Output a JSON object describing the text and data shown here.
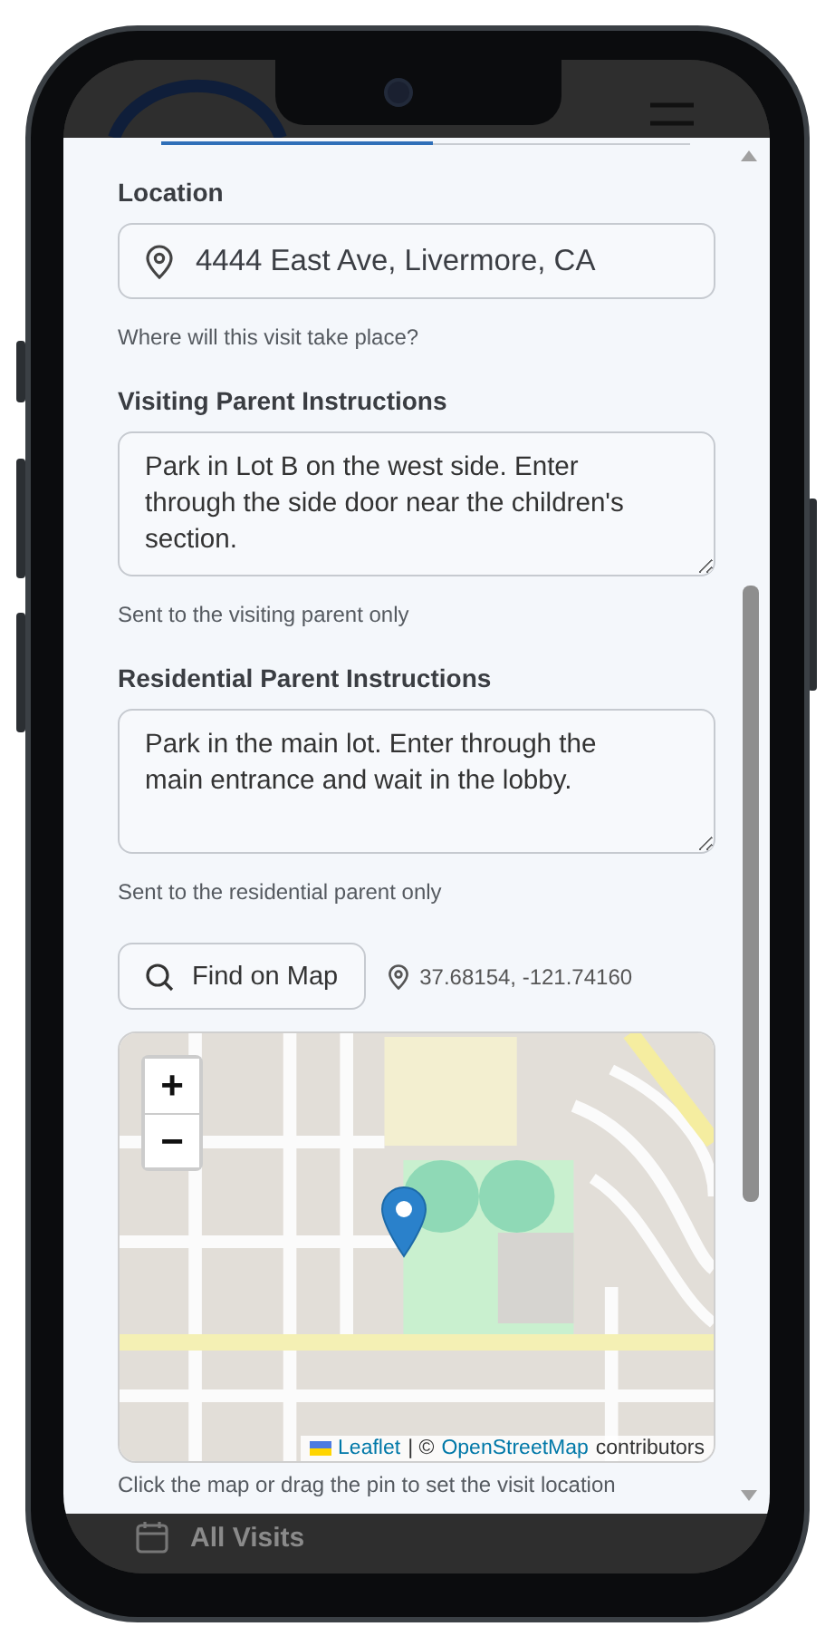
{
  "background_page": {
    "nav_item": "All Visits"
  },
  "location": {
    "label": "Location",
    "value": "4444 East Ave, Livermore, CA",
    "hint": "Where will this visit take place?"
  },
  "visiting_instructions": {
    "label": "Visiting Parent Instructions",
    "value": "Park in Lot B on the west side. Enter through the side door near the children's section.",
    "hint": "Sent to the visiting parent only"
  },
  "residential_instructions": {
    "label": "Residential Parent Instructions",
    "value": "Park in the main lot. Enter through the main entrance and wait in the lobby.",
    "hint": "Sent to the residential parent only"
  },
  "find_button": "Find on Map",
  "coordinates": "37.68154, -121.74160",
  "map": {
    "kind": "picture",
    "zoom_in": "+",
    "zoom_out": "−",
    "attribution": {
      "leaflet": "Leaflet",
      "separator": "| ©",
      "osm": "OpenStreetMap",
      "suffix": "contributors"
    }
  },
  "map_hint": "Click the map or drag the pin to set the visit location"
}
